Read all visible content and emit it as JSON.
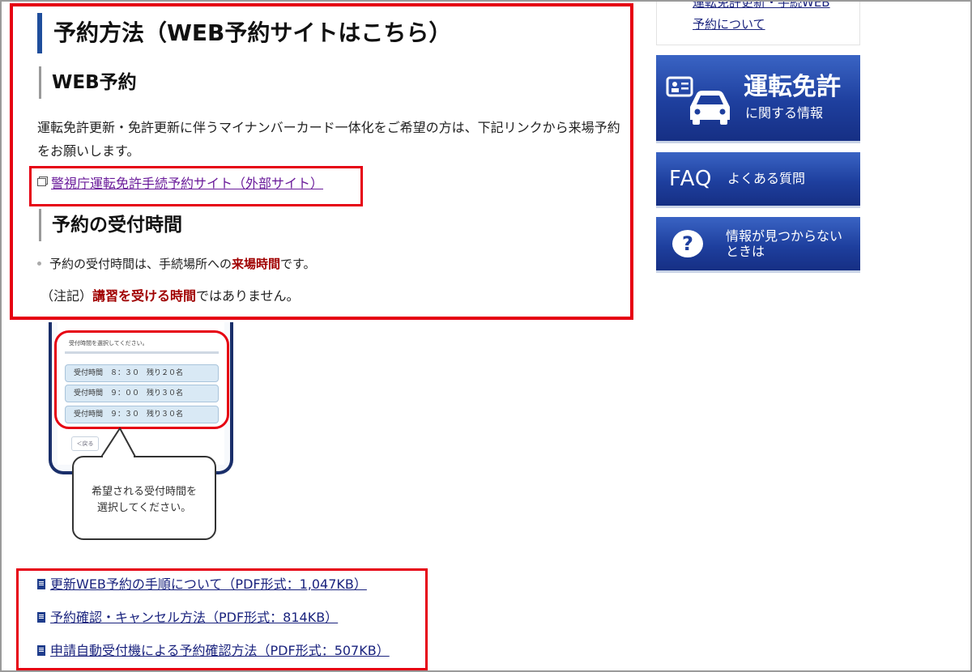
{
  "main": {
    "section_title": "予約方法（WEB予約サイトはこちら）",
    "web_heading": "WEB予約",
    "description": "運転免許更新・免許更新に伴うマイナンバーカード一体化をご希望の方は、下記リンクから来場予約をお願いします。",
    "external_link": "警視庁運転免許手続予約サイト（外部サイト）",
    "time_heading": "予約の受付時間",
    "bullet_prefix": "予約の受付時間は、手続場所への",
    "bullet_em": "来場時間",
    "bullet_suffix": "です。",
    "note_prefix": "（注記）",
    "note_em": "講習を受ける時間",
    "note_suffix": "ではありません。"
  },
  "illustration": {
    "select_title": "受付時間を選択してください。",
    "slots": [
      "受付時間　８：３０　残り２０名",
      "受付時間　９：００　残り３０名",
      "受付時間　９：３０　残り３０名"
    ],
    "back_button": "＜戻る",
    "bubble_line1": "希望される受付時間を",
    "bubble_line2": "選択してください。"
  },
  "pdf_links": [
    "更新WEB予約の手順について（PDF形式：1,047KB）",
    "予約確認・キャンセル方法（PDF形式：814KB）",
    "申請自動受付機による予約確認方法（PDF形式：507KB）"
  ],
  "sidebar": {
    "top_link_line1": "運転免許更新・手続WEB",
    "top_link_line2": "予約について",
    "license_title": "運転免許",
    "license_sub": "に関する情報",
    "faq_word": "FAQ",
    "faq_sub": "よくある質問",
    "help_line1": "情報が見つからない",
    "help_line2": "ときは",
    "help_icon": "?"
  },
  "colors": {
    "highlight_red": "#e60012",
    "heading_blue": "#1f4e9c",
    "banner_blue": "#1e3f9e",
    "emphasis": "#a00000",
    "visited_link": "#6a1b9a"
  }
}
